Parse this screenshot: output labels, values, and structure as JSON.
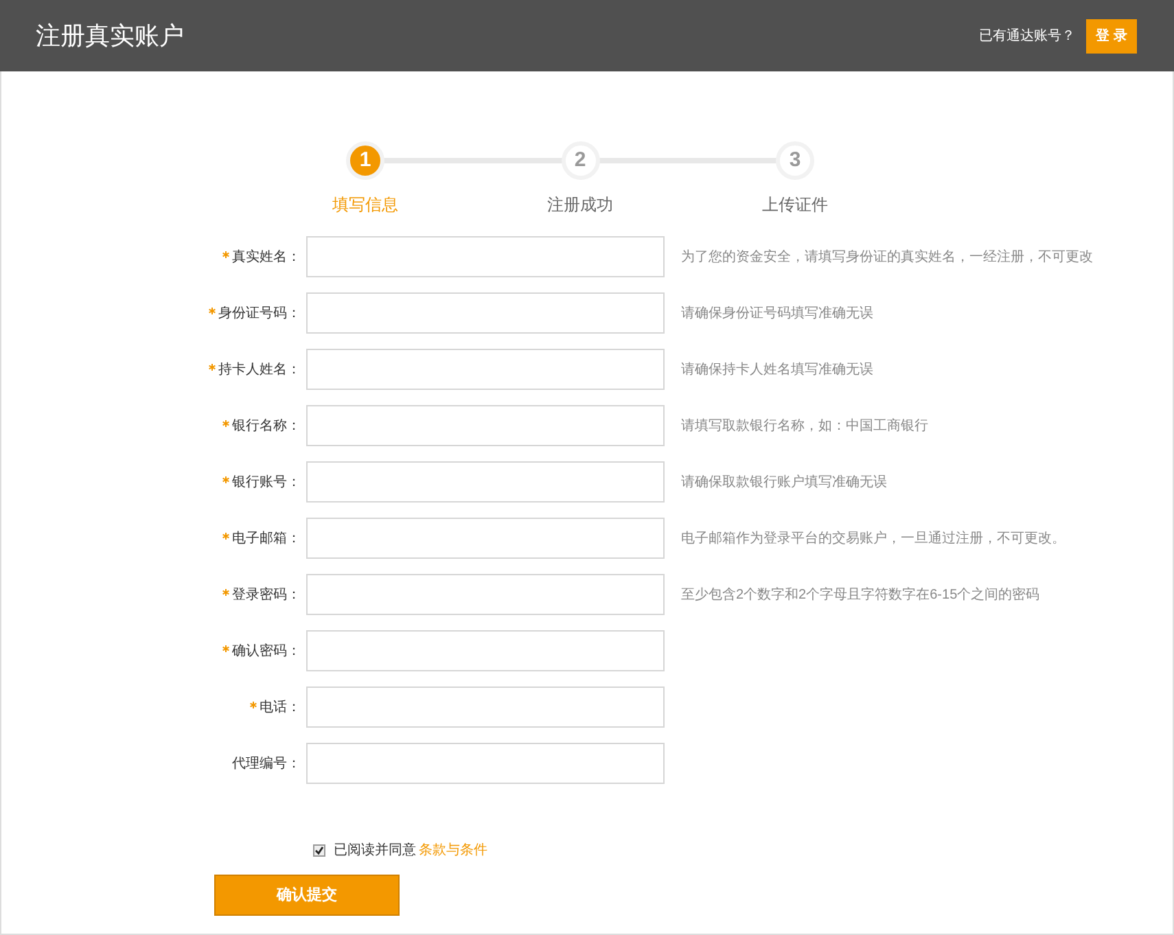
{
  "header": {
    "title": "注册真实账户",
    "prompt": "已有通达账号？",
    "login_button": "登 录"
  },
  "steps": [
    {
      "number": "1",
      "label": "填写信息",
      "selected": true
    },
    {
      "number": "2",
      "label": "注册成功",
      "selected": false
    },
    {
      "number": "3",
      "label": "上传证件",
      "selected": false
    }
  ],
  "fields": [
    {
      "label": "真实姓名：",
      "required": true,
      "hint": "为了您的资金安全，请填写身份证的真实姓名，一经注册，不可更改"
    },
    {
      "label": "身份证号码：",
      "required": true,
      "hint": "请确保身份证号码填写准确无误"
    },
    {
      "label": "持卡人姓名：",
      "required": true,
      "hint": "请确保持卡人姓名填写准确无误"
    },
    {
      "label": "银行名称：",
      "required": true,
      "hint": "请填写取款银行名称，如：中国工商银行"
    },
    {
      "label": "银行账号：",
      "required": true,
      "hint": "请确保取款银行账户填写准确无误"
    },
    {
      "label": "电子邮箱：",
      "required": true,
      "hint": "电子邮箱作为登录平台的交易账户，一旦通过注册，不可更改。"
    },
    {
      "label": "登录密码：",
      "required": true,
      "hint": "至少包含2个数字和2个字母且字符数字在6-15个之间的密码"
    },
    {
      "label": "确认密码：",
      "required": true
    },
    {
      "label": "电话：",
      "required": true
    },
    {
      "label": "代理编号：",
      "required": false
    }
  ],
  "agreement": {
    "checked": true,
    "text": "已阅读并同意",
    "link": "条款与条件"
  },
  "submit_button": "确认提交"
}
